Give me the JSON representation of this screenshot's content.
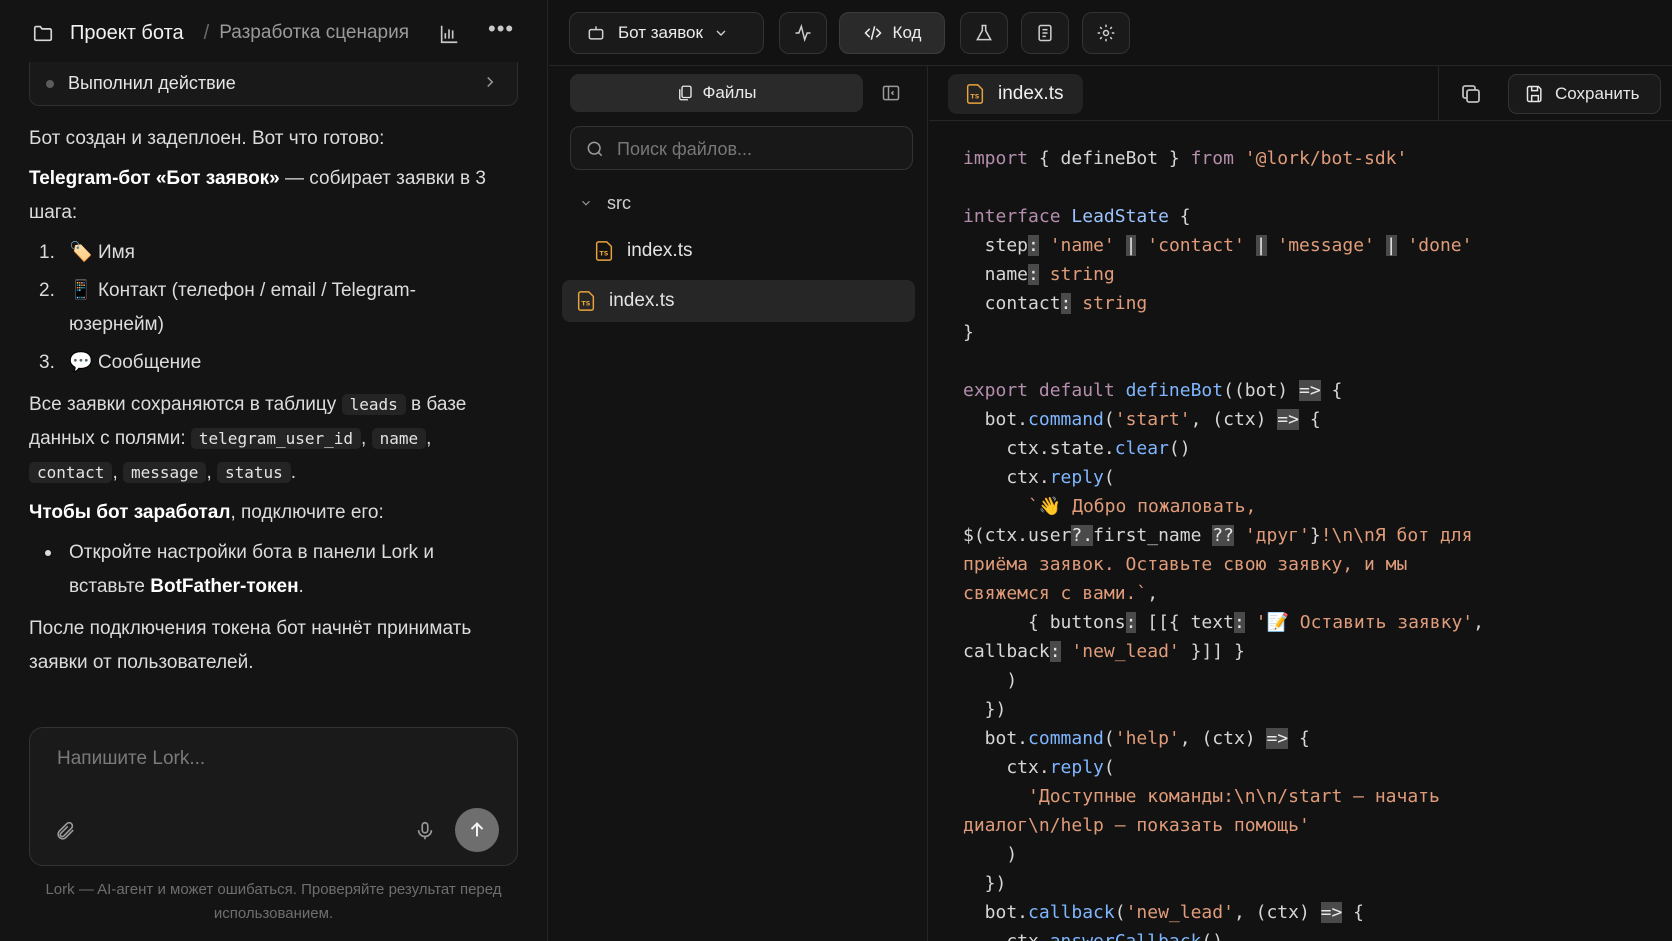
{
  "header": {
    "project": "Проект бота",
    "separator": "/",
    "breadcrumb": "Разработка сценария"
  },
  "chat": {
    "action_card_label": "Выполнил действие",
    "intro": "Бот создан и задеплоен. Вот что готово:",
    "bot_title": "Telegram-бот «Бот заявок»",
    "bot_desc": " — собирает заявки в 3 шага:",
    "steps": [
      {
        "num": "1.",
        "emoji": "🏷️",
        "text": "Имя"
      },
      {
        "num": "2.",
        "emoji": "📱",
        "text": "Контакт (телефон / email / Telegram-юзернейм)"
      },
      {
        "num": "3.",
        "emoji": "💬",
        "text": "Сообщение"
      }
    ],
    "storage_1": "Все заявки сохраняются в таблицу ",
    "storage_table": "leads",
    "storage_2": " в базе данных с полями: ",
    "fields": [
      "telegram_user_id",
      "name",
      "contact",
      "message",
      "status"
    ],
    "storage_end": ".",
    "connect_bold": "Чтобы бот заработал",
    "connect_rest": ", подключите его:",
    "bullet_1": "Откройте настройки бота в панели Lork и вставьте ",
    "bullet_bold": "BotFather-токен",
    "bullet_end": ".",
    "outro": "После подключения токена бот начнёт принимать заявки от пользователей."
  },
  "composer": {
    "placeholder": "Напишите Lork...",
    "disclaimer": "Lork — AI-агент и может ошибаться. Проверяйте результат перед использованием."
  },
  "toolbar": {
    "bot_select": "Бот заявок",
    "code_label": "Код"
  },
  "files_panel": {
    "tab_label": "Файлы",
    "search_placeholder": "Поиск файлов...",
    "folder": "src",
    "nested_file": "index.ts",
    "selected_file": "index.ts"
  },
  "editor": {
    "tab_label": "index.ts",
    "save_label": "Сохранить"
  },
  "colors": {
    "accent_ts": "#e8a33d",
    "keyword": "#b48ead",
    "string": "#e09c7a",
    "function": "#7fb6ff"
  }
}
